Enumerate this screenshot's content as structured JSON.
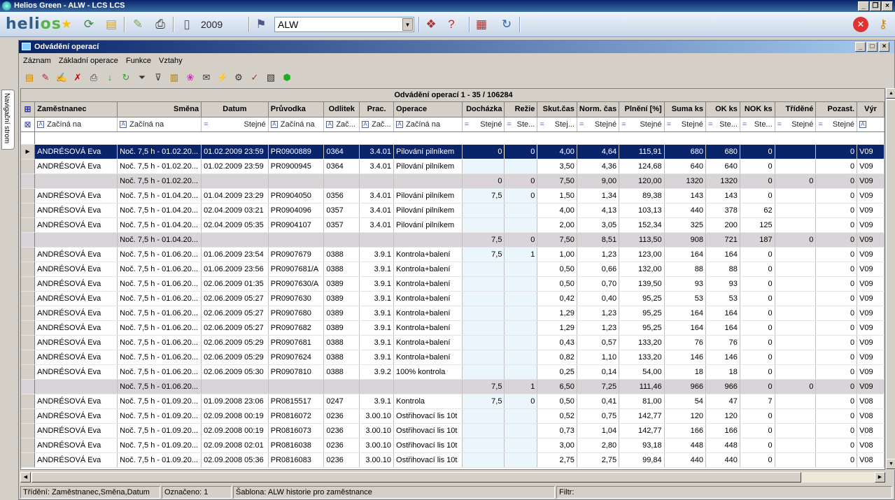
{
  "app": {
    "title": "Helios Green - ALW - LCS LCS",
    "year": "2009",
    "company": "ALW",
    "logo_a": "heli",
    "logo_b": "os"
  },
  "side": {
    "nav_tab": "Navigační strom"
  },
  "window": {
    "title": "Odvádění operací"
  },
  "menu": [
    "Záznam",
    "Základní operace",
    "Funkce",
    "Vztahy"
  ],
  "grid": {
    "title": "Odvádění operací  1 - 35 / 106284",
    "columns": [
      "Zaměstnanec",
      "Směna",
      "Datum",
      "Průvodka",
      "Odlitek",
      "Prac.",
      "Operace",
      "Docházka",
      "Režie",
      "Skut.čas",
      "Norm. čas",
      "Plnění [%]",
      "Suma ks",
      "OK ks",
      "NOK ks",
      "Tříděné",
      "Pozast.",
      "Výr"
    ],
    "filters": [
      "Začíná na",
      "Začíná na",
      "Stejné",
      "Začíná na",
      "Zač...",
      "Zač...",
      "Začíná na",
      "Stejné",
      "Ste...",
      "Stej...",
      "Stejné",
      "Stejné",
      "Stejné",
      "Ste...",
      "Ste...",
      "Stejné",
      "Stejné",
      ""
    ],
    "rows": [
      {
        "t": "sel",
        "c": [
          "ANDRÉSOVÁ  Eva",
          "Noč. 7,5 h - 01.02.20...",
          "01.02.2009 23:59",
          "PR0900889",
          "0364",
          "3.4.01",
          "Pilování pilníkem",
          "0",
          "0",
          "4,00",
          "4,64",
          "115,91",
          "680",
          "680",
          "0",
          "",
          "0",
          "V09"
        ]
      },
      {
        "t": "",
        "c": [
          "ANDRÉSOVÁ  Eva",
          "Noč. 7,5 h - 01.02.20...",
          "01.02.2009 23:59",
          "PR0900945",
          "0364",
          "3.4.01",
          "Pilování pilníkem",
          "",
          "",
          "3,50",
          "4,36",
          "124,68",
          "640",
          "640",
          "0",
          "",
          "0",
          "V09"
        ]
      },
      {
        "t": "sum",
        "c": [
          "",
          "Noč. 7,5 h - 01.02.20...",
          "",
          "",
          "",
          "",
          "",
          "0",
          "0",
          "7,50",
          "9,00",
          "120,00",
          "1320",
          "1320",
          "0",
          "0",
          "0",
          "V09"
        ]
      },
      {
        "t": "",
        "c": [
          "ANDRÉSOVÁ  Eva",
          "Noč. 7,5 h - 01.04.20...",
          "01.04.2009 23:29",
          "PR0904050",
          "0356",
          "3.4.01",
          "Pilování pilníkem",
          "7,5",
          "0",
          "1,50",
          "1,34",
          "89,38",
          "143",
          "143",
          "0",
          "",
          "0",
          "V09"
        ]
      },
      {
        "t": "",
        "c": [
          "ANDRÉSOVÁ  Eva",
          "Noč. 7,5 h - 01.04.20...",
          "02.04.2009 03:21",
          "PR0904096",
          "0357",
          "3.4.01",
          "Pilování pilníkem",
          "",
          "",
          "4,00",
          "4,13",
          "103,13",
          "440",
          "378",
          "62",
          "",
          "0",
          "V09"
        ]
      },
      {
        "t": "",
        "c": [
          "ANDRÉSOVÁ  Eva",
          "Noč. 7,5 h - 01.04.20...",
          "02.04.2009 05:35",
          "PR0904107",
          "0357",
          "3.4.01",
          "Pilování pilníkem",
          "",
          "",
          "2,00",
          "3,05",
          "152,34",
          "325",
          "200",
          "125",
          "",
          "0",
          "V09"
        ]
      },
      {
        "t": "sum",
        "c": [
          "",
          "Noč. 7,5 h - 01.04.20...",
          "",
          "",
          "",
          "",
          "",
          "7,5",
          "0",
          "7,50",
          "8,51",
          "113,50",
          "908",
          "721",
          "187",
          "0",
          "0",
          "V09"
        ]
      },
      {
        "t": "",
        "c": [
          "ANDRÉSOVÁ  Eva",
          "Noč. 7,5 h - 01.06.20...",
          "01.06.2009 23:54",
          "PR0907679",
          "0388",
          "3.9.1",
          "Kontrola+balení",
          "7,5",
          "1",
          "1,00",
          "1,23",
          "123,00",
          "164",
          "164",
          "0",
          "",
          "0",
          "V09"
        ]
      },
      {
        "t": "",
        "c": [
          "ANDRÉSOVÁ  Eva",
          "Noč. 7,5 h - 01.06.20...",
          "01.06.2009 23:56",
          "PR0907681/A",
          "0388",
          "3.9.1",
          "Kontrola+balení",
          "",
          "",
          "0,50",
          "0,66",
          "132,00",
          "88",
          "88",
          "0",
          "",
          "0",
          "V09"
        ]
      },
      {
        "t": "",
        "c": [
          "ANDRÉSOVÁ  Eva",
          "Noč. 7,5 h - 01.06.20...",
          "02.06.2009 01:35",
          "PR0907630/A",
          "0389",
          "3.9.1",
          "Kontrola+balení",
          "",
          "",
          "0,50",
          "0,70",
          "139,50",
          "93",
          "93",
          "0",
          "",
          "0",
          "V09"
        ]
      },
      {
        "t": "",
        "c": [
          "ANDRÉSOVÁ  Eva",
          "Noč. 7,5 h - 01.06.20...",
          "02.06.2009 05:27",
          "PR0907630",
          "0389",
          "3.9.1",
          "Kontrola+balení",
          "",
          "",
          "0,42",
          "0,40",
          "95,25",
          "53",
          "53",
          "0",
          "",
          "0",
          "V09"
        ]
      },
      {
        "t": "",
        "c": [
          "ANDRÉSOVÁ  Eva",
          "Noč. 7,5 h - 01.06.20...",
          "02.06.2009 05:27",
          "PR0907680",
          "0389",
          "3.9.1",
          "Kontrola+balení",
          "",
          "",
          "1,29",
          "1,23",
          "95,25",
          "164",
          "164",
          "0",
          "",
          "0",
          "V09"
        ]
      },
      {
        "t": "",
        "c": [
          "ANDRÉSOVÁ  Eva",
          "Noč. 7,5 h - 01.06.20...",
          "02.06.2009 05:27",
          "PR0907682",
          "0389",
          "3.9.1",
          "Kontrola+balení",
          "",
          "",
          "1,29",
          "1,23",
          "95,25",
          "164",
          "164",
          "0",
          "",
          "0",
          "V09"
        ]
      },
      {
        "t": "",
        "c": [
          "ANDRÉSOVÁ  Eva",
          "Noč. 7,5 h - 01.06.20...",
          "02.06.2009 05:29",
          "PR0907681",
          "0388",
          "3.9.1",
          "Kontrola+balení",
          "",
          "",
          "0,43",
          "0,57",
          "133,20",
          "76",
          "76",
          "0",
          "",
          "0",
          "V09"
        ]
      },
      {
        "t": "",
        "c": [
          "ANDRÉSOVÁ  Eva",
          "Noč. 7,5 h - 01.06.20...",
          "02.06.2009 05:29",
          "PR0907624",
          "0388",
          "3.9.1",
          "Kontrola+balení",
          "",
          "",
          "0,82",
          "1,10",
          "133,20",
          "146",
          "146",
          "0",
          "",
          "0",
          "V09"
        ]
      },
      {
        "t": "",
        "c": [
          "ANDRÉSOVÁ  Eva",
          "Noč. 7,5 h - 01.06.20...",
          "02.06.2009 05:30",
          "PR0907810",
          "0388",
          "3.9.2",
          "100% kontrola",
          "",
          "",
          "0,25",
          "0,14",
          "54,00",
          "18",
          "18",
          "0",
          "",
          "0",
          "V09"
        ]
      },
      {
        "t": "sum",
        "c": [
          "",
          "Noč. 7,5 h - 01.06.20...",
          "",
          "",
          "",
          "",
          "",
          "7,5",
          "1",
          "6,50",
          "7,25",
          "111,46",
          "966",
          "966",
          "0",
          "0",
          "0",
          "V09"
        ]
      },
      {
        "t": "",
        "c": [
          "ANDRÉSOVÁ  Eva",
          "Noč. 7,5 h - 01.09.20...",
          "01.09.2008 23:06",
          "PR0815517",
          "0247",
          "3.9.1",
          "Kontrola",
          "7,5",
          "0",
          "0,50",
          "0,41",
          "81,00",
          "54",
          "47",
          "7",
          "",
          "0",
          "V08"
        ]
      },
      {
        "t": "",
        "c": [
          "ANDRÉSOVÁ  Eva",
          "Noč. 7,5 h - 01.09.20...",
          "02.09.2008 00:19",
          "PR0816072",
          "0236",
          "3.00.10",
          "Ostřihovací lis 10t",
          "",
          "",
          "0,52",
          "0,75",
          "142,77",
          "120",
          "120",
          "0",
          "",
          "0",
          "V08"
        ]
      },
      {
        "t": "",
        "c": [
          "ANDRÉSOVÁ  Eva",
          "Noč. 7,5 h - 01.09.20...",
          "02.09.2008 00:19",
          "PR0816073",
          "0236",
          "3.00.10",
          "Ostřihovací lis 10t",
          "",
          "",
          "0,73",
          "1,04",
          "142,77",
          "166",
          "166",
          "0",
          "",
          "0",
          "V08"
        ]
      },
      {
        "t": "",
        "c": [
          "ANDRÉSOVÁ  Eva",
          "Noč. 7,5 h - 01.09.20...",
          "02.09.2008 02:01",
          "PR0816038",
          "0236",
          "3.00.10",
          "Ostřihovací lis 10t",
          "",
          "",
          "3,00",
          "2,80",
          "93,18",
          "448",
          "448",
          "0",
          "",
          "0",
          "V08"
        ]
      },
      {
        "t": "",
        "c": [
          "ANDRÉSOVÁ  Eva",
          "Noč. 7,5 h - 01.09.20...",
          "02.09.2008 05:36",
          "PR0816083",
          "0236",
          "3.00.10",
          "Ostřihovací lis 10t",
          "",
          "",
          "2,75",
          "2,75",
          "99,84",
          "440",
          "440",
          "0",
          "",
          "0",
          "V08"
        ]
      }
    ]
  },
  "status": {
    "sort": "Třídění: Zaměstnanec,Směna,Datum",
    "marked": "Označeno: 1",
    "template": "Šablona: ALW historie pro zaměstnance",
    "filter": "Filtr:"
  }
}
